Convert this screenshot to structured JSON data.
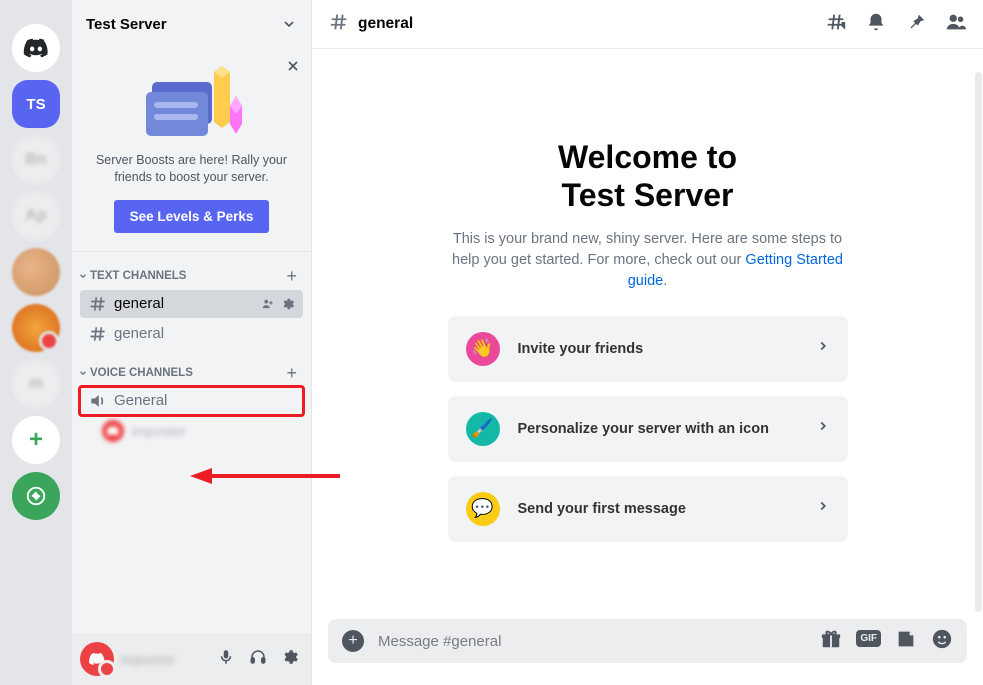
{
  "brand": "Discord",
  "rail": {
    "selected_initials": "TS"
  },
  "sidebar": {
    "server_name": "Test Server",
    "boost": {
      "text": "Server Boosts are here! Rally your friends to boost your server.",
      "button": "See Levels & Perks"
    },
    "text_channels_label": "TEXT CHANNELS",
    "voice_channels_label": "VOICE CHANNELS",
    "text_channels": [
      {
        "name": "general",
        "active": true
      },
      {
        "name": "general",
        "active": false
      }
    ],
    "voice_channels": [
      {
        "name": "General"
      }
    ]
  },
  "topbar": {
    "channel": "general"
  },
  "welcome": {
    "line1": "Welcome to",
    "line2": "Test Server",
    "desc_a": "This is your brand new, shiny server. Here are some steps to help you get started. For more, check out our ",
    "desc_link": "Getting Started guide",
    "desc_b": ".",
    "cards": [
      "Invite your friends",
      "Personalize your server with an icon",
      "Send your first message"
    ]
  },
  "composer": {
    "placeholder": "Message #general"
  }
}
